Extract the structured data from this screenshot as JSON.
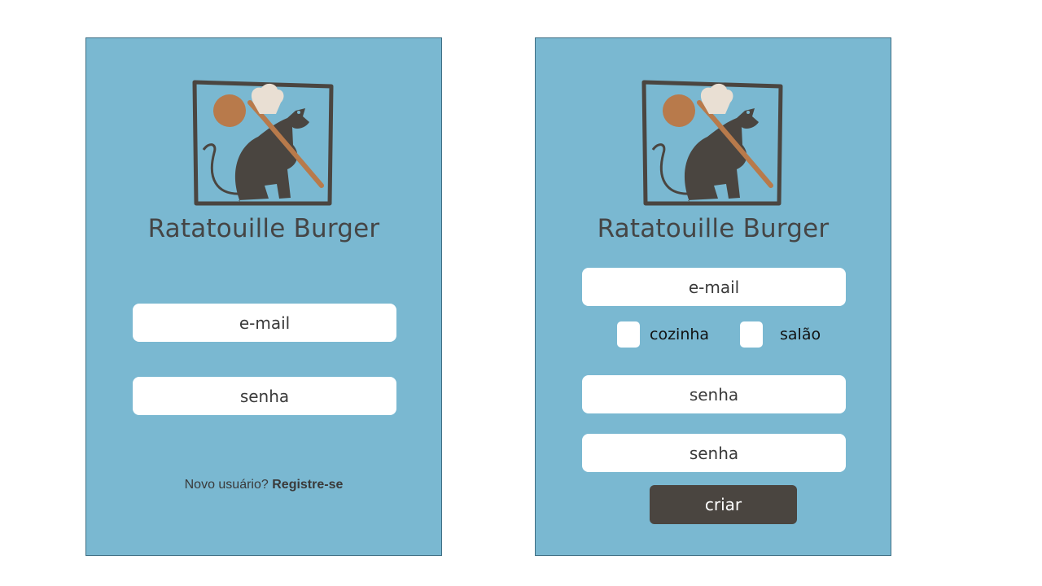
{
  "theme": {
    "panel_bg": "#7ab8d1",
    "button_bg": "#4a4540",
    "logo_dark": "#4a4540",
    "logo_spoon": "#b87a4b",
    "logo_hat": "#e9dfd3"
  },
  "login": {
    "app_title": "Ratatouille Burger",
    "email_placeholder": "e-mail",
    "password_placeholder": "senha",
    "new_user_text": "Novo usuário?",
    "register_link": "Registre-se"
  },
  "register": {
    "app_title": "Ratatouille Burger",
    "email_placeholder": "e-mail",
    "roles": [
      {
        "label": "cozinha",
        "checked": false
      },
      {
        "label": "salão",
        "checked": false
      }
    ],
    "password_placeholder": "senha",
    "password_confirm_placeholder": "senha",
    "submit_label": "criar"
  },
  "icons": {
    "logo": "rat-chef-logo-icon"
  }
}
